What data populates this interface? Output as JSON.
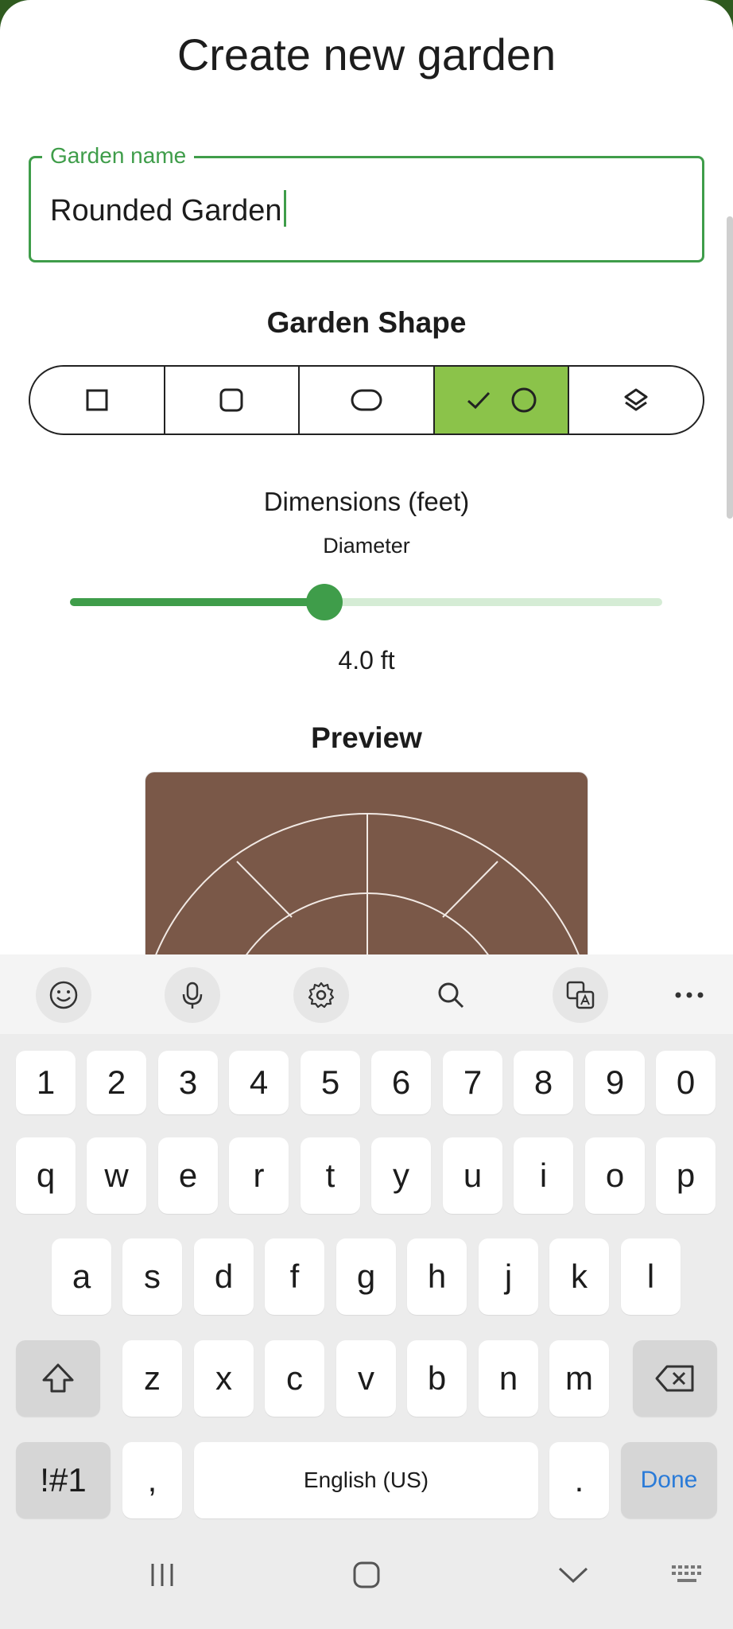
{
  "header": {
    "title": "Create new garden"
  },
  "name_field": {
    "label": "Garden name",
    "value": "Rounded Garden"
  },
  "shape": {
    "title": "Garden Shape",
    "options": [
      {
        "icon": "square-icon",
        "selected": false
      },
      {
        "icon": "rounded-square-icon",
        "selected": false
      },
      {
        "icon": "pill-icon",
        "selected": false
      },
      {
        "icon": "circle-icon",
        "selected": true
      },
      {
        "icon": "layers-icon",
        "selected": false
      }
    ],
    "check_icon": "check-icon"
  },
  "dimensions": {
    "title": "Dimensions (feet)",
    "label": "Diameter",
    "value_text": "4.0 ft",
    "slider_fraction": 0.43
  },
  "preview": {
    "title": "Preview"
  },
  "colors": {
    "accent": "#3f9d4a",
    "selected_segment": "#8bc34a",
    "soil": "#7a5848",
    "done_key": "#2a7bd8"
  },
  "keyboard": {
    "toolbar": [
      "emoji-icon",
      "microphone-icon",
      "settings-icon",
      "search-icon",
      "translate-icon",
      "more-icon"
    ],
    "rows": [
      [
        "1",
        "2",
        "3",
        "4",
        "5",
        "6",
        "7",
        "8",
        "9",
        "0"
      ],
      [
        "q",
        "w",
        "e",
        "r",
        "t",
        "y",
        "u",
        "i",
        "o",
        "p"
      ],
      [
        "a",
        "s",
        "d",
        "f",
        "g",
        "h",
        "j",
        "k",
        "l"
      ],
      [
        "z",
        "x",
        "c",
        "v",
        "b",
        "n",
        "m"
      ]
    ],
    "symbols_key": "!#1",
    "comma_key": ",",
    "space_key": "English (US)",
    "period_key": ".",
    "done_key": "Done"
  },
  "navbar": [
    "recents-icon",
    "home-icon",
    "back-icon",
    "keyboard-icon"
  ]
}
